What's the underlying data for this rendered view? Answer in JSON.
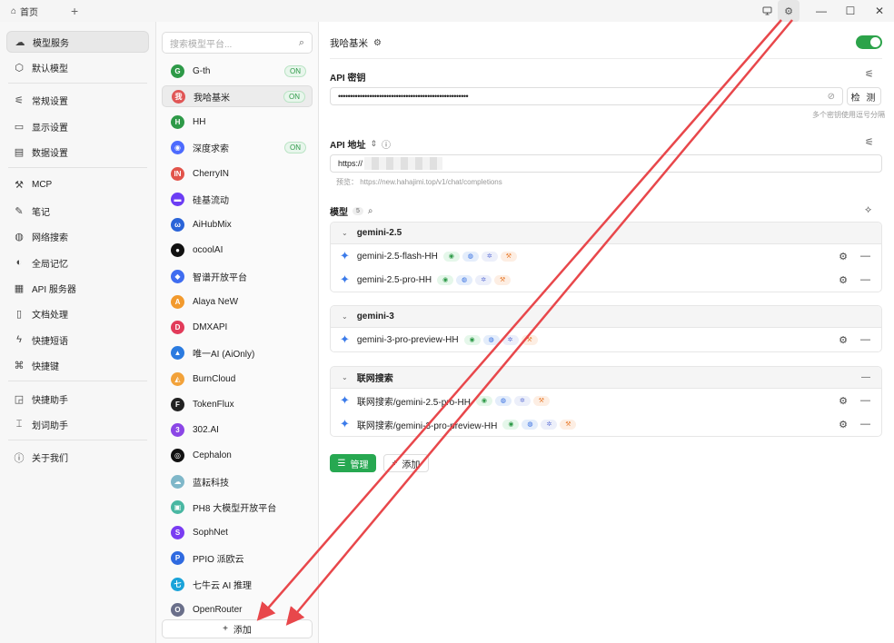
{
  "titlebar": {
    "home_tab": "首页",
    "new_tab": "+",
    "controls": [
      "monitor-icon",
      "settings-icon",
      "minimize-icon",
      "maximize-icon",
      "close-icon"
    ]
  },
  "nav": [
    {
      "label": "模型服务",
      "icon": "cloud-icon",
      "active": true
    },
    {
      "label": "默认模型",
      "icon": "cube-icon"
    },
    {
      "sep": true
    },
    {
      "label": "常规设置",
      "icon": "sliders-icon"
    },
    {
      "label": "显示设置",
      "icon": "display-icon"
    },
    {
      "label": "数据设置",
      "icon": "hard-drive-icon"
    },
    {
      "sep": true
    },
    {
      "label": "MCP",
      "icon": "mcp-icon"
    },
    {
      "label": "笔记",
      "icon": "notes-icon"
    },
    {
      "label": "网络搜索",
      "icon": "globe-icon"
    },
    {
      "label": "全局记忆",
      "icon": "memory-icon"
    },
    {
      "label": "API 服务器",
      "icon": "server-icon"
    },
    {
      "label": "文档处理",
      "icon": "document-icon"
    },
    {
      "label": "快捷短语",
      "icon": "zap-icon"
    },
    {
      "label": "快捷键",
      "icon": "command-icon"
    },
    {
      "sep": true
    },
    {
      "label": "快捷助手",
      "icon": "assistant-icon"
    },
    {
      "label": "划词助手",
      "icon": "text-select-icon"
    },
    {
      "sep": true
    },
    {
      "label": "关于我们",
      "icon": "info-icon"
    }
  ],
  "providers": {
    "search_placeholder": "搜索模型平台...",
    "add_label": "添加",
    "items": [
      {
        "name": "G-th",
        "logo": "G",
        "color": "#2e9a48",
        "on": true
      },
      {
        "name": "我哈基米",
        "logo": "我",
        "color": "#e05656",
        "on": true,
        "active": true
      },
      {
        "name": "HH",
        "logo": "H",
        "color": "#2e9a48"
      },
      {
        "name": "深度求索",
        "logo": "◉",
        "color": "#4d6bfe",
        "on": true
      },
      {
        "name": "CherryIN",
        "logo": "IN",
        "color": "#e2544b"
      },
      {
        "name": "硅基流动",
        "logo": "▬",
        "color": "#6c3df4"
      },
      {
        "name": "AiHubMix",
        "logo": "ω",
        "color": "#2a64d8"
      },
      {
        "name": "ocoolAI",
        "logo": "●",
        "color": "#111111"
      },
      {
        "name": "智谱开放平台",
        "logo": "◆",
        "color": "#3f6df0"
      },
      {
        "name": "Alaya NeW",
        "logo": "A",
        "color": "#f29a2e"
      },
      {
        "name": "DMXAPI",
        "logo": "D",
        "color": "#e23b5a"
      },
      {
        "name": "唯一AI (AiOnly)",
        "logo": "▲",
        "color": "#2b7be0"
      },
      {
        "name": "BurnCloud",
        "logo": "◭",
        "color": "#f2a23a"
      },
      {
        "name": "TokenFlux",
        "logo": "F",
        "color": "#222222"
      },
      {
        "name": "302.AI",
        "logo": "3",
        "color": "#8b46e6"
      },
      {
        "name": "Cephalon",
        "logo": "◎",
        "color": "#111111"
      },
      {
        "name": "蓝耘科技",
        "logo": "☁",
        "color": "#7fb7c9"
      },
      {
        "name": "PH8 大模型开放平台",
        "logo": "▣",
        "color": "#49b7a2"
      },
      {
        "name": "SophNet",
        "logo": "S",
        "color": "#7a3cf2"
      },
      {
        "name": "PPIO 派欧云",
        "logo": "P",
        "color": "#2f6ae0"
      },
      {
        "name": "七牛云 AI 推理",
        "logo": "七",
        "color": "#1aa3d9"
      },
      {
        "name": "OpenRouter",
        "logo": "O",
        "color": "#6a6f8a"
      }
    ],
    "on_label": "ON"
  },
  "main": {
    "provider_title": "我哈基米",
    "api_key_label": "API 密钥",
    "api_key_value": "••••••••••••••••••••••••••••••••••••••••••••••••••••••",
    "check_label": "检 测",
    "api_key_hint": "多个密钥使用逗号分隔",
    "api_url_label": "API 地址",
    "api_url_value": "https://",
    "api_url_preview": "预览：  https://new.hahajimi.top/v1/chat/completions",
    "models_label": "模型",
    "models_count": "5",
    "manage_label": "管理",
    "add_label": "添加",
    "groups": [
      {
        "name": "gemini-2.5",
        "models": [
          "gemini-2.5-flash-HH",
          "gemini-2.5-pro-HH"
        ]
      },
      {
        "name": "gemini-3",
        "models": [
          "gemini-3-pro-preview-HH"
        ]
      },
      {
        "name": "联网搜索",
        "models": [
          "联网搜索/gemini-2.5-pro-HH",
          "联网搜索/gemini-3-pro-preview-HH"
        ],
        "collapsible": true
      }
    ]
  },
  "colors": {
    "accent": "#27a851",
    "annotation_arrow": "#e8474b"
  }
}
